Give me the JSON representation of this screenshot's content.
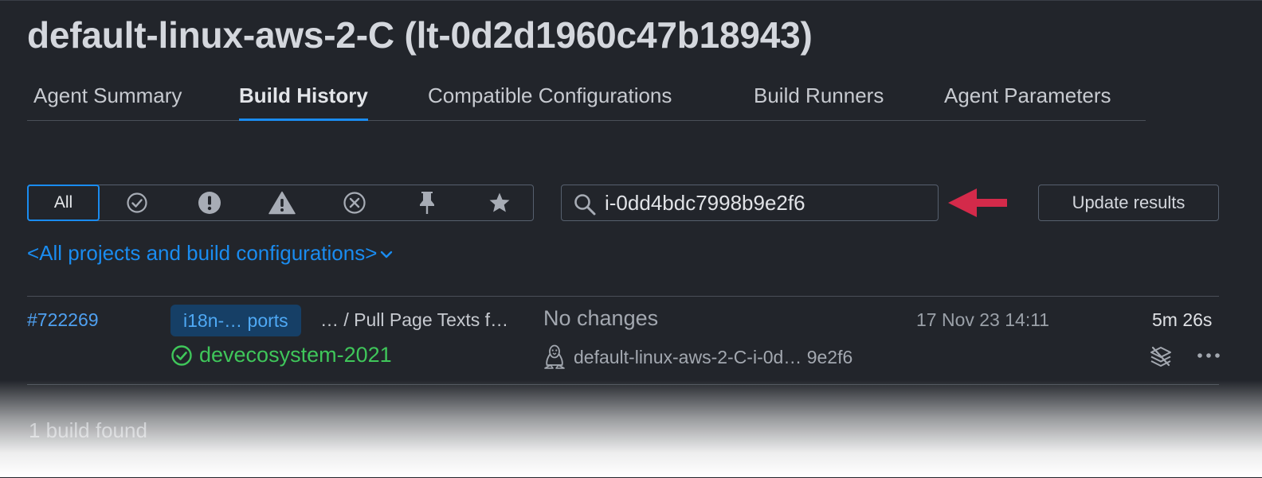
{
  "page": {
    "title": "default-linux-aws-2-C (lt-0d2d1960c47b18943)"
  },
  "tabs": [
    {
      "label": "Agent Summary",
      "active": false
    },
    {
      "label": "Build History",
      "active": true
    },
    {
      "label": "Compatible Configurations",
      "active": false
    },
    {
      "label": "Build Runners",
      "active": false
    },
    {
      "label": "Agent Parameters",
      "active": false
    }
  ],
  "filters": {
    "all_label": "All",
    "icons": [
      "check-circle-icon",
      "exclamation-circle-icon",
      "warning-triangle-icon",
      "cancel-circle-icon",
      "pin-icon",
      "star-icon"
    ]
  },
  "search": {
    "value": "i-0dd4bdc7998b9e2f6"
  },
  "update_button": {
    "label": "Update results"
  },
  "project_selector": {
    "label": "<All projects and build configurations>"
  },
  "builds": [
    {
      "number": "#722269",
      "project_badge": "i18n-… ports",
      "config_path": "… / Pull Page Texts f…",
      "changes": "No changes",
      "date": "17 Nov 23 14:11",
      "duration": "5m 26s",
      "status_text": "devecosystem-2021",
      "agent": "default-linux-aws-2-C-i-0d… 9e2f6"
    }
  ],
  "summary": {
    "found_text": "1 build found"
  },
  "colors": {
    "background": "#22252b",
    "accent": "#1a8cf0",
    "success": "#3fc65a",
    "annotation_arrow": "#d42a4a"
  }
}
